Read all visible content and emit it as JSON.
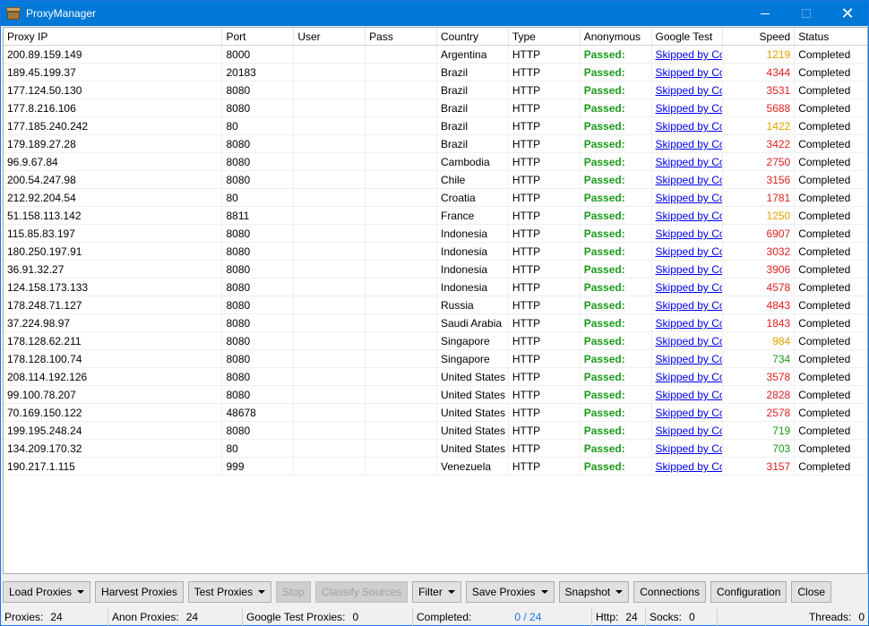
{
  "window": {
    "title": "ProxyManager"
  },
  "columns": {
    "ip": "Proxy IP",
    "port": "Port",
    "user": "User",
    "pass": "Pass",
    "country": "Country",
    "type": "Type",
    "anon": "Anonymous",
    "gtest": "Google Test",
    "speed": "Speed",
    "status": "Status"
  },
  "colors": {
    "fast": "#1a9a1a",
    "medium": "#e0a000",
    "slow": "#e02020",
    "passed": "#1a9a1a",
    "accent": "#0078d7"
  },
  "rows": [
    {
      "ip": "200.89.159.149",
      "port": "8000",
      "user": "",
      "pass": "",
      "country": "Argentina",
      "type": "HTTP",
      "anon": "Passed:",
      "gtest": "Skipped by Co",
      "speed": "1219",
      "speed_level": "medium",
      "status": "Completed"
    },
    {
      "ip": "189.45.199.37",
      "port": "20183",
      "user": "",
      "pass": "",
      "country": "Brazil",
      "type": "HTTP",
      "anon": "Passed:",
      "gtest": "Skipped by Co",
      "speed": "4344",
      "speed_level": "slow",
      "status": "Completed"
    },
    {
      "ip": "177.124.50.130",
      "port": "8080",
      "user": "",
      "pass": "",
      "country": "Brazil",
      "type": "HTTP",
      "anon": "Passed:",
      "gtest": "Skipped by Co",
      "speed": "3531",
      "speed_level": "slow",
      "status": "Completed"
    },
    {
      "ip": "177.8.216.106",
      "port": "8080",
      "user": "",
      "pass": "",
      "country": "Brazil",
      "type": "HTTP",
      "anon": "Passed:",
      "gtest": "Skipped by Co",
      "speed": "5688",
      "speed_level": "slow",
      "status": "Completed"
    },
    {
      "ip": "177.185.240.242",
      "port": "80",
      "user": "",
      "pass": "",
      "country": "Brazil",
      "type": "HTTP",
      "anon": "Passed:",
      "gtest": "Skipped by Co",
      "speed": "1422",
      "speed_level": "medium",
      "status": "Completed"
    },
    {
      "ip": "179.189.27.28",
      "port": "8080",
      "user": "",
      "pass": "",
      "country": "Brazil",
      "type": "HTTP",
      "anon": "Passed:",
      "gtest": "Skipped by Co",
      "speed": "3422",
      "speed_level": "slow",
      "status": "Completed"
    },
    {
      "ip": "96.9.67.84",
      "port": "8080",
      "user": "",
      "pass": "",
      "country": "Cambodia",
      "type": "HTTP",
      "anon": "Passed:",
      "gtest": "Skipped by Co",
      "speed": "2750",
      "speed_level": "slow",
      "status": "Completed"
    },
    {
      "ip": "200.54.247.98",
      "port": "8080",
      "user": "",
      "pass": "",
      "country": "Chile",
      "type": "HTTP",
      "anon": "Passed:",
      "gtest": "Skipped by Co",
      "speed": "3156",
      "speed_level": "slow",
      "status": "Completed"
    },
    {
      "ip": "212.92.204.54",
      "port": "80",
      "user": "",
      "pass": "",
      "country": "Croatia",
      "type": "HTTP",
      "anon": "Passed:",
      "gtest": "Skipped by Co",
      "speed": "1781",
      "speed_level": "slow",
      "status": "Completed"
    },
    {
      "ip": "51.158.113.142",
      "port": "8811",
      "user": "",
      "pass": "",
      "country": "France",
      "type": "HTTP",
      "anon": "Passed:",
      "gtest": "Skipped by Co",
      "speed": "1250",
      "speed_level": "medium",
      "status": "Completed"
    },
    {
      "ip": "115.85.83.197",
      "port": "8080",
      "user": "",
      "pass": "",
      "country": "Indonesia",
      "type": "HTTP",
      "anon": "Passed:",
      "gtest": "Skipped by Co",
      "speed": "6907",
      "speed_level": "slow",
      "status": "Completed"
    },
    {
      "ip": "180.250.197.91",
      "port": "8080",
      "user": "",
      "pass": "",
      "country": "Indonesia",
      "type": "HTTP",
      "anon": "Passed:",
      "gtest": "Skipped by Co",
      "speed": "3032",
      "speed_level": "slow",
      "status": "Completed"
    },
    {
      "ip": "36.91.32.27",
      "port": "8080",
      "user": "",
      "pass": "",
      "country": "Indonesia",
      "type": "HTTP",
      "anon": "Passed:",
      "gtest": "Skipped by Co",
      "speed": "3906",
      "speed_level": "slow",
      "status": "Completed"
    },
    {
      "ip": "124.158.173.133",
      "port": "8080",
      "user": "",
      "pass": "",
      "country": "Indonesia",
      "type": "HTTP",
      "anon": "Passed:",
      "gtest": "Skipped by Co",
      "speed": "4578",
      "speed_level": "slow",
      "status": "Completed"
    },
    {
      "ip": "178.248.71.127",
      "port": "8080",
      "user": "",
      "pass": "",
      "country": "Russia",
      "type": "HTTP",
      "anon": "Passed:",
      "gtest": "Skipped by Co",
      "speed": "4843",
      "speed_level": "slow",
      "status": "Completed"
    },
    {
      "ip": "37.224.98.97",
      "port": "8080",
      "user": "",
      "pass": "",
      "country": "Saudi Arabia",
      "type": "HTTP",
      "anon": "Passed:",
      "gtest": "Skipped by Co",
      "speed": "1843",
      "speed_level": "slow",
      "status": "Completed"
    },
    {
      "ip": "178.128.62.211",
      "port": "8080",
      "user": "",
      "pass": "",
      "country": "Singapore",
      "type": "HTTP",
      "anon": "Passed:",
      "gtest": "Skipped by Co",
      "speed": "984",
      "speed_level": "medium",
      "status": "Completed"
    },
    {
      "ip": "178.128.100.74",
      "port": "8080",
      "user": "",
      "pass": "",
      "country": "Singapore",
      "type": "HTTP",
      "anon": "Passed:",
      "gtest": "Skipped by Co",
      "speed": "734",
      "speed_level": "fast",
      "status": "Completed"
    },
    {
      "ip": "208.114.192.126",
      "port": "8080",
      "user": "",
      "pass": "",
      "country": "United States",
      "type": "HTTP",
      "anon": "Passed:",
      "gtest": "Skipped by Co",
      "speed": "3578",
      "speed_level": "slow",
      "status": "Completed"
    },
    {
      "ip": "99.100.78.207",
      "port": "8080",
      "user": "",
      "pass": "",
      "country": "United States",
      "type": "HTTP",
      "anon": "Passed:",
      "gtest": "Skipped by Co",
      "speed": "2828",
      "speed_level": "slow",
      "status": "Completed"
    },
    {
      "ip": "70.169.150.122",
      "port": "48678",
      "user": "",
      "pass": "",
      "country": "United States",
      "type": "HTTP",
      "anon": "Passed:",
      "gtest": "Skipped by Co",
      "speed": "2578",
      "speed_level": "slow",
      "status": "Completed"
    },
    {
      "ip": "199.195.248.24",
      "port": "8080",
      "user": "",
      "pass": "",
      "country": "United States",
      "type": "HTTP",
      "anon": "Passed:",
      "gtest": "Skipped by Co",
      "speed": "719",
      "speed_level": "fast",
      "status": "Completed"
    },
    {
      "ip": "134.209.170.32",
      "port": "80",
      "user": "",
      "pass": "",
      "country": "United States",
      "type": "HTTP",
      "anon": "Passed:",
      "gtest": "Skipped by Co",
      "speed": "703",
      "speed_level": "fast",
      "status": "Completed"
    },
    {
      "ip": "190.217.1.115",
      "port": "999",
      "user": "",
      "pass": "",
      "country": "Venezuela",
      "type": "HTTP",
      "anon": "Passed:",
      "gtest": "Skipped by Co",
      "speed": "3157",
      "speed_level": "slow",
      "status": "Completed"
    }
  ],
  "buttons": [
    {
      "id": "load-proxies",
      "label": "Load Proxies",
      "dropdown": true,
      "enabled": true
    },
    {
      "id": "harvest-proxies",
      "label": "Harvest Proxies",
      "dropdown": false,
      "enabled": true
    },
    {
      "id": "test-proxies",
      "label": "Test Proxies",
      "dropdown": true,
      "enabled": true
    },
    {
      "id": "stop",
      "label": "Stop",
      "dropdown": false,
      "enabled": false
    },
    {
      "id": "classify-sources",
      "label": "Classify Sources",
      "dropdown": false,
      "enabled": false
    },
    {
      "id": "filter",
      "label": "Filter",
      "dropdown": true,
      "enabled": true
    },
    {
      "id": "save-proxies",
      "label": "Save Proxies",
      "dropdown": true,
      "enabled": true
    },
    {
      "id": "snapshot",
      "label": "Snapshot",
      "dropdown": true,
      "enabled": true
    },
    {
      "id": "connections",
      "label": "Connections",
      "dropdown": false,
      "enabled": true
    },
    {
      "id": "configuration",
      "label": "Configuration",
      "dropdown": false,
      "enabled": true
    },
    {
      "id": "close",
      "label": "Close",
      "dropdown": false,
      "enabled": true
    }
  ],
  "statusbar": {
    "proxies_label": "Proxies:",
    "proxies_value": "24",
    "anon_label": "Anon Proxies:",
    "anon_value": "24",
    "google_label": "Google Test Proxies:",
    "google_value": "0",
    "completed_label": "Completed:",
    "completed_value": "0 / 24",
    "http_label": "Http:",
    "http_value": "24",
    "socks_label": "Socks:",
    "socks_value": "0",
    "threads_label": "Threads:",
    "threads_value": "0"
  }
}
